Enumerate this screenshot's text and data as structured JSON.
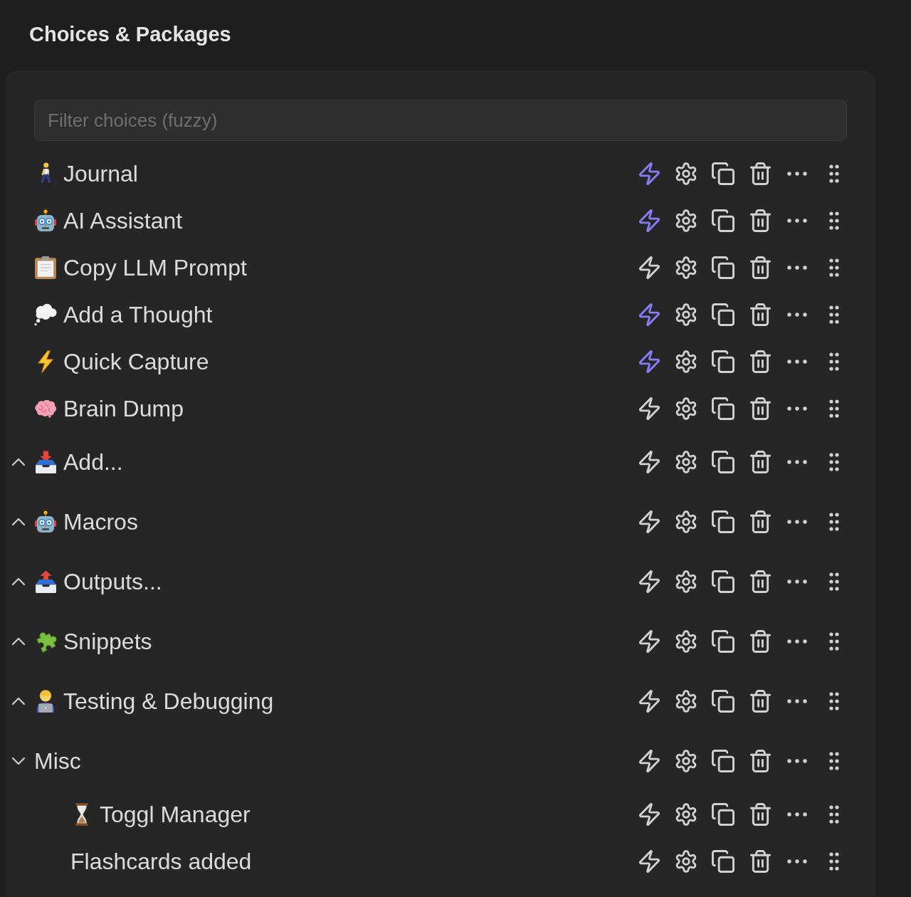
{
  "title": "Choices & Packages",
  "filter": {
    "placeholder": "Filter choices (fuzzy)"
  },
  "choices": [
    {
      "kind": "choice",
      "label": "Journal",
      "command_enabled": true
    },
    {
      "kind": "choice",
      "label": "AI Assistant",
      "command_enabled": true
    },
    {
      "kind": "choice",
      "label": "Copy LLM Prompt",
      "command_enabled": false
    },
    {
      "kind": "choice",
      "label": "Add a Thought",
      "command_enabled": true
    },
    {
      "kind": "choice",
      "label": "Quick Capture",
      "command_enabled": true
    },
    {
      "kind": "choice",
      "label": "Brain Dump",
      "command_enabled": false
    },
    {
      "kind": "multi",
      "label": "Add...",
      "expanded": false,
      "command_enabled": false
    },
    {
      "kind": "multi",
      "label": "Macros",
      "expanded": false,
      "command_enabled": false
    },
    {
      "kind": "multi",
      "label": "Outputs...",
      "expanded": false,
      "command_enabled": false
    },
    {
      "kind": "multi",
      "label": "Snippets",
      "expanded": false,
      "command_enabled": false
    },
    {
      "kind": "multi",
      "label": "Testing & Debugging",
      "expanded": false,
      "command_enabled": false
    },
    {
      "kind": "multi",
      "label": "Misc",
      "expanded": true,
      "command_enabled": false,
      "children": [
        {
          "kind": "choice",
          "label": "Toggl Manager",
          "command_enabled": false
        },
        {
          "kind": "choice",
          "label": "Flashcards added",
          "command_enabled": false
        }
      ]
    }
  ]
}
